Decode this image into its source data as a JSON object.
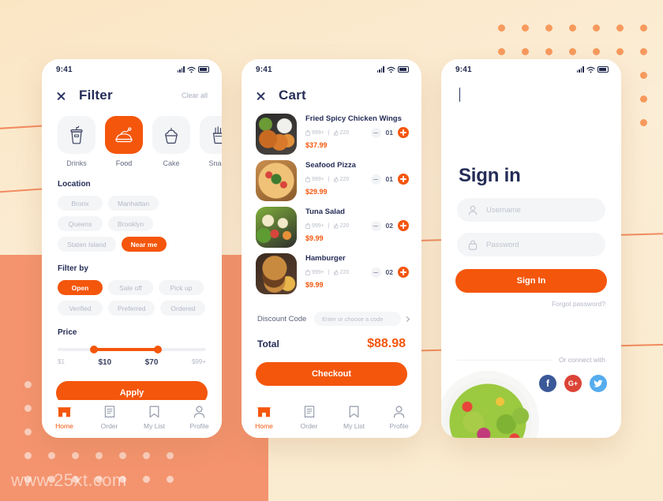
{
  "background": {
    "cream_color": "#FAEBCE",
    "salmon_color": "#F4946F",
    "accent_color": "#F4560C",
    "watermark": "www.25xt.com"
  },
  "screens": {
    "filter": {
      "statusbar": {
        "time": "9:41"
      },
      "header": {
        "close_icon": "close-icon",
        "title": "Filter",
        "clear_all": "Clear all"
      },
      "categories": [
        {
          "label": "Drinks",
          "icon": "drink-cup-icon",
          "active": false
        },
        {
          "label": "Food",
          "icon": "roast-chicken-icon",
          "active": true
        },
        {
          "label": "Cake",
          "icon": "cupcake-icon",
          "active": false
        },
        {
          "label": "Snack",
          "icon": "fries-icon",
          "active": false
        }
      ],
      "location": {
        "title": "Location",
        "chips": [
          {
            "label": "Bronx",
            "selected": false
          },
          {
            "label": "Manhattan",
            "selected": false
          },
          {
            "label": "Queens",
            "selected": false
          },
          {
            "label": "Brooklyn",
            "selected": false
          },
          {
            "label": "Staten Island",
            "selected": false
          },
          {
            "label": "Near me",
            "selected": true
          }
        ]
      },
      "filter_by": {
        "title": "Filter by",
        "chips": [
          {
            "label": "Open",
            "selected": true
          },
          {
            "label": "Sale off",
            "selected": false
          },
          {
            "label": "Pick up",
            "selected": false
          },
          {
            "label": "Verified",
            "selected": false
          },
          {
            "label": "Preferred",
            "selected": false
          },
          {
            "label": "Ordered",
            "selected": false
          }
        ]
      },
      "price": {
        "title": "Price",
        "min_tick": "$1",
        "low_value": "$10",
        "high_value": "$70",
        "max_tick": "$99+"
      },
      "apply_label": "Apply"
    },
    "cart": {
      "statusbar": {
        "time": "9:41"
      },
      "header": {
        "close_icon": "close-icon",
        "title": "Cart"
      },
      "items": [
        {
          "name": "Fried Spicy Chicken Wings",
          "orders": "999+",
          "likes": "220",
          "price": "$37.99",
          "qty": "01",
          "thumb": "thumb-wings"
        },
        {
          "name": "Seafood Pizza",
          "orders": "999+",
          "likes": "220",
          "price": "$29.99",
          "qty": "01",
          "thumb": "thumb-pizza"
        },
        {
          "name": "Tuna Salad",
          "orders": "999+",
          "likes": "220",
          "price": "$9.99",
          "qty": "02",
          "thumb": "thumb-salad"
        },
        {
          "name": "Hamburger",
          "orders": "999+",
          "likes": "220",
          "price": "$9.99",
          "qty": "02",
          "thumb": "thumb-burger"
        }
      ],
      "discount": {
        "label": "Discount Code",
        "placeholder": "Enter or choose a code"
      },
      "total": {
        "label": "Total",
        "value": "$88.98"
      },
      "checkout_label": "Checkout"
    },
    "signin": {
      "statusbar": {
        "time": "9:41"
      },
      "back_icon": "back-chevron-icon",
      "title": "Sign in",
      "username_placeholder": "Username",
      "password_placeholder": "Password",
      "submit_label": "Sign In",
      "forgot_label": "Forgot password?",
      "connect_label": "Or connect with",
      "socials": [
        {
          "name": "facebook",
          "glyph": "f",
          "color": "#3B5998"
        },
        {
          "name": "google-plus",
          "glyph": "G+",
          "color": "#DB4437"
        },
        {
          "name": "twitter",
          "glyph": "ᵗ",
          "color": "#55ACEE"
        }
      ]
    }
  },
  "bottom_nav": [
    {
      "label": "Home",
      "icon": "store-icon",
      "active": true
    },
    {
      "label": "Order",
      "icon": "receipt-icon",
      "active": false
    },
    {
      "label": "My List",
      "icon": "bookmark-icon",
      "active": false
    },
    {
      "label": "Profile",
      "icon": "person-icon",
      "active": false
    }
  ]
}
